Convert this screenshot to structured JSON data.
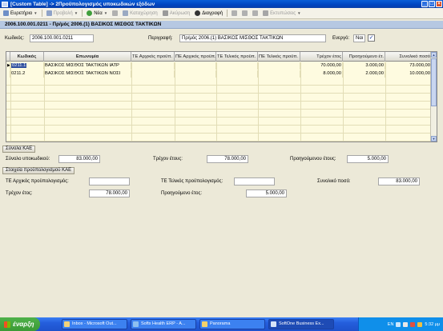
{
  "window": {
    "title": "[Custom Table] -> 2Προϋπολογισμός υποκωδικών εξόδων"
  },
  "toolbar": {
    "items": [
      {
        "label": "Ευρετήριο",
        "icon": "index-icon",
        "color": "#6F8FC7",
        "disabled": false,
        "dropdown": true
      },
      {
        "label": "Προβολή",
        "icon": "view-icon",
        "color": "#8FA3C8",
        "disabled": true,
        "dropdown": true
      },
      {
        "label": "Νέα",
        "icon": "new-icon",
        "color": "#3F9E3C",
        "disabled": false,
        "dropdown": true
      },
      {
        "label": "",
        "icon": "delete-icon",
        "color": "#B0B0B0",
        "disabled": true,
        "dropdown": false
      },
      {
        "label": "Καταχώρηση",
        "icon": "save-icon",
        "color": "#9AA9C2",
        "disabled": true,
        "dropdown": false
      },
      {
        "label": "Ακύρωση",
        "icon": "undo-icon",
        "color": "#9A9A9A",
        "disabled": true,
        "dropdown": false
      },
      {
        "label": "Διαγραφή",
        "icon": "delete-record-icon",
        "color": "#333333",
        "disabled": false,
        "dropdown": false
      },
      {
        "label": "",
        "icon": "tool-icon",
        "color": "#B0B0B0",
        "disabled": true,
        "dropdown": false
      },
      {
        "label": "",
        "icon": "tool2-icon",
        "color": "#B0B0B0",
        "disabled": true,
        "dropdown": false
      },
      {
        "label": "",
        "icon": "tool3-icon",
        "color": "#B0B0B0",
        "disabled": true,
        "dropdown": false
      },
      {
        "label": "Εκτυπώσεις",
        "icon": "print-icon",
        "color": "#A6A6A6",
        "disabled": true,
        "dropdown": true
      }
    ]
  },
  "header": {
    "title": "2006.100.001.0211 - Πρ/μός 2006.(1) ΒΑΣΙΚΟΣ ΜΙΣΘΟΣ ΤΑΚΤΙΚΩΝ"
  },
  "form": {
    "code_label": "Κωδικός:",
    "code_value": "2006.100.001.0211",
    "description_label": "Περιγραφή:",
    "description_value": "Πρ/μός 2006.(1) ΒΑΣΙΚΟΣ ΜΙΣΘΟΣ ΤΑΚΤΙΚΩΝ",
    "active_label": "Ενεργό:",
    "active_value": "Ναι",
    "active_checked": "✓"
  },
  "grid": {
    "columns": [
      "Κωδικός",
      "Επωνυμία",
      "ΤΕ Αρχικός προϋπ.",
      "ΠΕ Αρχικός προϋπ.",
      "ΤΕ Τελικός προϋπ.",
      "ΠΕ Τελικός προϋπ.",
      "Τρέχον έτος",
      "Προηγούμενο έτ.",
      "Συνολικό ποσό"
    ],
    "rows": [
      {
        "code": "0211.1",
        "name": "ΒΑΣΙΚΟΣ ΜΙΣΘΟΣ ΤΑΚΤΙΚΩΝ ΙΑΤΡ",
        "te_initial": "",
        "pe_initial": "",
        "te_final": "",
        "pe_final": "",
        "current": "70.000,00",
        "previous": "3.000,00",
        "total": "73.000,00"
      },
      {
        "code": "0211.2",
        "name": "ΒΑΣΙΚΟΣ ΜΙΣΘΟΣ ΤΑΚΤΙΚΩΝ ΝΟΣΙ",
        "te_initial": "",
        "pe_initial": "",
        "te_final": "",
        "pe_final": "",
        "current": "8.000,00",
        "previous": "2.000,00",
        "total": "10.000,00"
      }
    ],
    "row_pointer": "▶"
  },
  "totals": {
    "tab_label": "Σύνολα ΚΑΕ",
    "subcode_total_label": "Σύνολο υποκωδικού:",
    "subcode_total_value": "83.000,00",
    "current_year_label": "Τρέχον έτους:",
    "current_year_value": "78.000,00",
    "previous_year_label": "Προηγούμενου έτους:",
    "previous_year_value": "5.000,00"
  },
  "budget": {
    "tab_label": "Στοιχεία προϋπολογισμού ΚΑΕ",
    "te_initial_label": "ΤΕ Αρχικός προϋπολογισμός:",
    "te_initial_value": "",
    "te_final_label": "ΤΕ Τελικός προϋπολογισμός:",
    "te_final_value": "",
    "total_amount_label": "Συνολικό ποσό:",
    "total_amount_value": "83.000,00",
    "current_year_label": "Τρέχον έτος:",
    "current_year_value": "78.000,00",
    "previous_year_label": "Προηγούμενο έτος:",
    "previous_year_value": "5.000,00"
  },
  "taskbar": {
    "start_label": "έναρξη",
    "tasks": [
      {
        "label": "Inbox - Microsoft Out...",
        "active": false
      },
      {
        "label": "Softx Health ERP - A...",
        "active": false
      },
      {
        "label": "Panorama",
        "active": false
      },
      {
        "label": "SoftOne Business Ex...",
        "active": true
      }
    ],
    "language": "EN",
    "clock": "5:32 μμ"
  }
}
